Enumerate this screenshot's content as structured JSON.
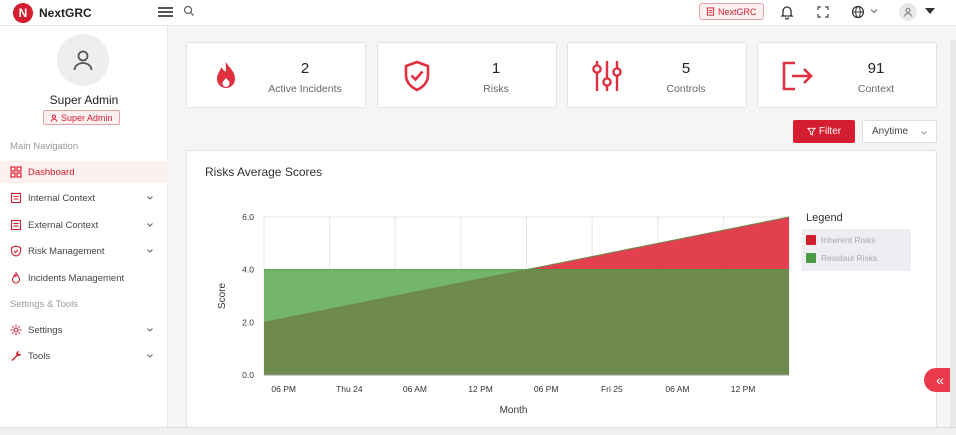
{
  "app": {
    "name": "NextGRC",
    "logo_letter": "N"
  },
  "header": {
    "org_chip": "NextGRC"
  },
  "profile": {
    "name": "Super Admin",
    "role": "Super Admin"
  },
  "nav": {
    "main_title": "Main Navigation",
    "main_items": [
      {
        "label": "Dashboard",
        "icon": "grid-icon",
        "active": true
      },
      {
        "label": "Internal Context",
        "icon": "document-icon",
        "expandable": true
      },
      {
        "label": "External Context",
        "icon": "document-icon",
        "expandable": true
      },
      {
        "label": "Risk Management",
        "icon": "shield-check-icon",
        "expandable": true
      },
      {
        "label": "Incidents Management",
        "icon": "fire-icon"
      }
    ],
    "tools_title": "Settings & Tools",
    "tools_items": [
      {
        "label": "Settings",
        "icon": "gear-icon",
        "expandable": true
      },
      {
        "label": "Tools",
        "icon": "wrench-icon",
        "expandable": true
      }
    ]
  },
  "stats": [
    {
      "value": "2",
      "label": "Active Incidents",
      "icon": "fire-icon"
    },
    {
      "value": "1",
      "label": "Risks",
      "icon": "shield-check-icon"
    },
    {
      "value": "5",
      "label": "Controls",
      "icon": "sliders-icon"
    },
    {
      "value": "91",
      "label": "Context",
      "icon": "exit-arrow-icon"
    }
  ],
  "filters": {
    "filter_label": "Filter",
    "time_range": "Anytime"
  },
  "colors": {
    "brand": "#d41d2e",
    "inherent": "#e0303f",
    "residual": "#5aa854"
  },
  "chart_data": {
    "type": "area",
    "title": "Risks Average Scores",
    "xlabel": "Month",
    "ylabel": "Score",
    "ylim": [
      0,
      6
    ],
    "yticks": [
      "0.0",
      "2.0",
      "4.0",
      "6.0"
    ],
    "x": [
      "06 PM",
      "Thu 24",
      "06 AM",
      "12 PM",
      "06 PM",
      "Fri 25",
      "06 AM",
      "12 PM"
    ],
    "grid": true,
    "legend_title": "Legend",
    "legend_position": "right",
    "series": [
      {
        "name": "Inherent Risks",
        "start": 2,
        "end": 6,
        "shape": "linear"
      },
      {
        "name": "Residaul Risks",
        "start": 4,
        "end": 4,
        "shape": "flat"
      }
    ]
  }
}
